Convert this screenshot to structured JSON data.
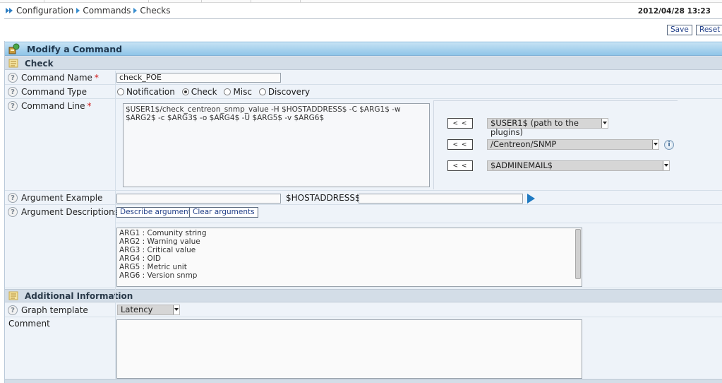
{
  "breadcrumb": [
    "Configuration",
    "Commands",
    "Checks"
  ],
  "datetime": "2012/04/28 13:23",
  "actions": {
    "save": "Save",
    "reset": "Reset"
  },
  "form_title": "Modify a Command",
  "section_check": "Check",
  "command_name": {
    "label": "Command Name",
    "required": "*",
    "value": "check_POE"
  },
  "command_type": {
    "label": "Command Type",
    "options": [
      "Notification",
      "Check",
      "Misc",
      "Discovery"
    ],
    "selected": "Check"
  },
  "command_line": {
    "label": "Command Line",
    "required": "*",
    "value": "$USER1$/check_centreon_snmp_value -H $HOSTADDRESS$ -C $ARG1$ -w $ARG2$ -c $ARG3$ -o $ARG4$ -U $ARG5$ -v $ARG6$",
    "insert_button": "< <",
    "macros": [
      "$USER1$ (path to the plugins)",
      "/Centreon/SNMP",
      "$ADMINEMAIL$"
    ]
  },
  "argument_example": {
    "label": "Argument Example",
    "value": "",
    "hostaddress_label": "$HOSTADDRESS$",
    "hostaddress_value": ""
  },
  "argument_descriptions": {
    "label": "Argument Descriptions",
    "describe_button": "Describe arguments",
    "clear_button": "Clear arguments",
    "lines": [
      "ARG1 : Comunity string",
      "ARG2 : Warning value",
      "ARG3 : Critical value",
      "ARG4 : OID",
      "ARG5 : Metric unit",
      "ARG6 : Version snmp"
    ]
  },
  "section_additional": "Additional Information",
  "graph_template": {
    "label": "Graph template",
    "value": "Latency"
  },
  "comment": {
    "label": "Comment",
    "value": ""
  },
  "colors": {
    "header_gradient_top": "#c6e2f4",
    "header_gradient_bottom": "#8fc5e8",
    "row_bg": "#eef3f9",
    "required": "#d01818",
    "link_blue": "#1f7ac2"
  }
}
